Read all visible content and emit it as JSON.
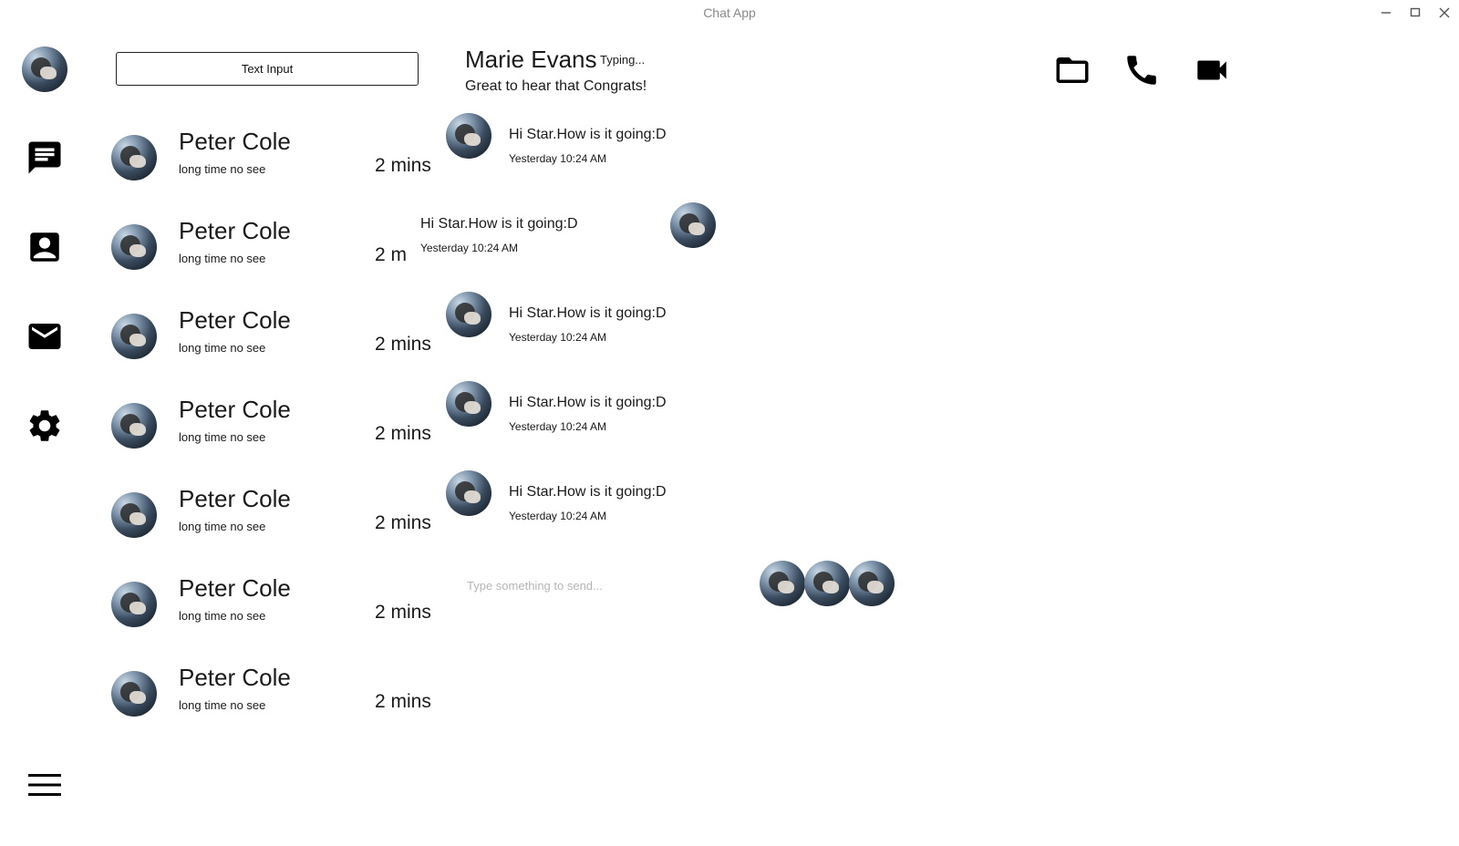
{
  "window": {
    "title": "Chat App",
    "controls": [
      "minimize-icon",
      "maximize-icon",
      "close-icon"
    ]
  },
  "rail": {
    "items": [
      {
        "icon": "chat-icon"
      },
      {
        "icon": "contact-card-icon"
      },
      {
        "icon": "mail-icon"
      },
      {
        "icon": "gear-icon"
      }
    ],
    "menu_icon": "hamburger-menu-icon"
  },
  "search": {
    "value": "Text Input"
  },
  "contacts": [
    {
      "name": "Peter Cole",
      "preview": "long time no see",
      "time": "2 mins"
    },
    {
      "name": "Peter Cole",
      "preview": "long time no see",
      "time": "2 m"
    },
    {
      "name": "Peter Cole",
      "preview": "long time no see",
      "time": "2 mins"
    },
    {
      "name": "Peter Cole",
      "preview": "long time no see",
      "time": "2 mins"
    },
    {
      "name": "Peter Cole",
      "preview": "long time no see",
      "time": "2 mins"
    },
    {
      "name": "Peter Cole",
      "preview": "long time no see",
      "time": "2 mins"
    },
    {
      "name": "Peter Cole",
      "preview": "long time no see",
      "time": "2 mins"
    }
  ],
  "chat": {
    "name": "Marie Evans",
    "typing": "Typing...",
    "status": "Great to hear that Congrats!",
    "header_icons": [
      "folder-icon",
      "phone-icon",
      "video-camera-icon"
    ],
    "messages": [
      {
        "text": "Hi Star.How is it going:D",
        "stamp": "Yesterday 10:24 AM",
        "side": "left"
      },
      {
        "text": "Hi Star.How is it going:D",
        "stamp": "Yesterday 10:24 AM",
        "side": "right"
      },
      {
        "text": "Hi Star.How is it going:D",
        "stamp": "Yesterday 10:24 AM",
        "side": "left"
      },
      {
        "text": "Hi Star.How is it going:D",
        "stamp": "Yesterday 10:24 AM",
        "side": "left"
      },
      {
        "text": "Hi Star.How is it going:D",
        "stamp": "Yesterday 10:24 AM",
        "side": "left"
      }
    ],
    "composer_placeholder": "Type something to send..."
  }
}
